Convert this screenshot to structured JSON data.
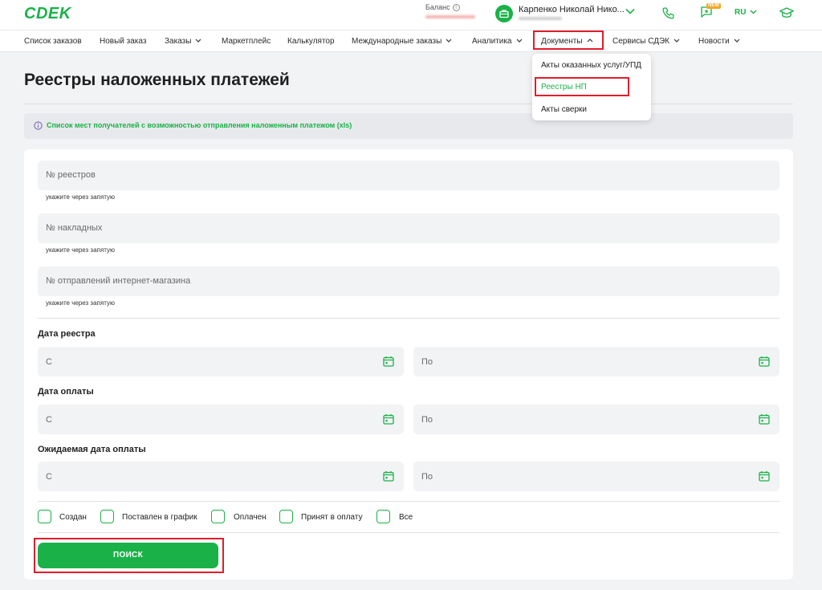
{
  "header": {
    "logo": "CDEK",
    "balance_label": "Баланс",
    "user_name": "Карпенко Николай Нико...",
    "new_badge": "NEW",
    "language": "RU"
  },
  "nav": {
    "items": [
      {
        "label": "Список заказов"
      },
      {
        "label": "Новый заказ"
      },
      {
        "label": "Заказы"
      },
      {
        "label": "Маркетплейс"
      },
      {
        "label": "Калькулятор"
      },
      {
        "label": "Международные заказы"
      },
      {
        "label": "Аналитика"
      },
      {
        "label": "Документы"
      },
      {
        "label": "Сервисы СДЭК"
      },
      {
        "label": "Новости"
      }
    ]
  },
  "dropdown": {
    "items": [
      {
        "label": "Акты оказанных услуг/УПД"
      },
      {
        "label": "Реестры НП"
      },
      {
        "label": "Акты сверки"
      }
    ]
  },
  "page": {
    "title": "Реестры наложенных платежей",
    "info_text": "Список мест получателей с возможностью отправления наложенным платежом (xls)"
  },
  "form": {
    "registry_numbers": {
      "placeholder": "№ реестров",
      "hint": "укажите через запятую"
    },
    "waybill_numbers": {
      "placeholder": "№ накладных",
      "hint": "укажите через запятую"
    },
    "shop_shipments": {
      "placeholder": "№ отправлений интернет-магазина",
      "hint": "укажите через запятую"
    },
    "registry_date": {
      "label": "Дата реестра",
      "from": "С",
      "to": "По"
    },
    "payment_date": {
      "label": "Дата оплаты",
      "from": "С",
      "to": "По"
    },
    "expected_payment_date": {
      "label": "Ожидаемая дата оплаты",
      "from": "С",
      "to": "По"
    },
    "statuses": [
      {
        "label": "Создан",
        "checked": false
      },
      {
        "label": "Поставлен в график",
        "checked": false
      },
      {
        "label": "Оплачен",
        "checked": false
      },
      {
        "label": "Принят в оплату",
        "checked": false
      },
      {
        "label": "Все",
        "checked": false
      }
    ],
    "search_label": "ПОИСК"
  },
  "colors": {
    "brand_green": "#1ab248",
    "highlight_red": "#e11d2a"
  }
}
